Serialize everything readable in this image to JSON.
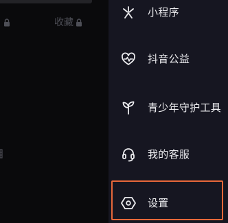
{
  "profile_tabs": [
    {
      "label": ""
    },
    {
      "label": "收藏"
    }
  ],
  "drawer_menu": {
    "items": [
      {
        "label": "小程序",
        "icon": "mini-program-icon"
      },
      {
        "label": "抖音公益",
        "icon": "heart-pulse-icon"
      },
      {
        "label": "青少年守护工具",
        "icon": "sprout-icon"
      },
      {
        "label": "我的客服",
        "icon": "headset-icon"
      },
      {
        "label": "设置",
        "icon": "settings-hexagon-icon"
      }
    ],
    "highlighted_item": "设置"
  },
  "colors": {
    "background": "#000000",
    "drawer_background": "#161621",
    "menu_text": "#ececef",
    "dimmed_text": "#4d4e56",
    "highlight_border": "#e8683a"
  }
}
